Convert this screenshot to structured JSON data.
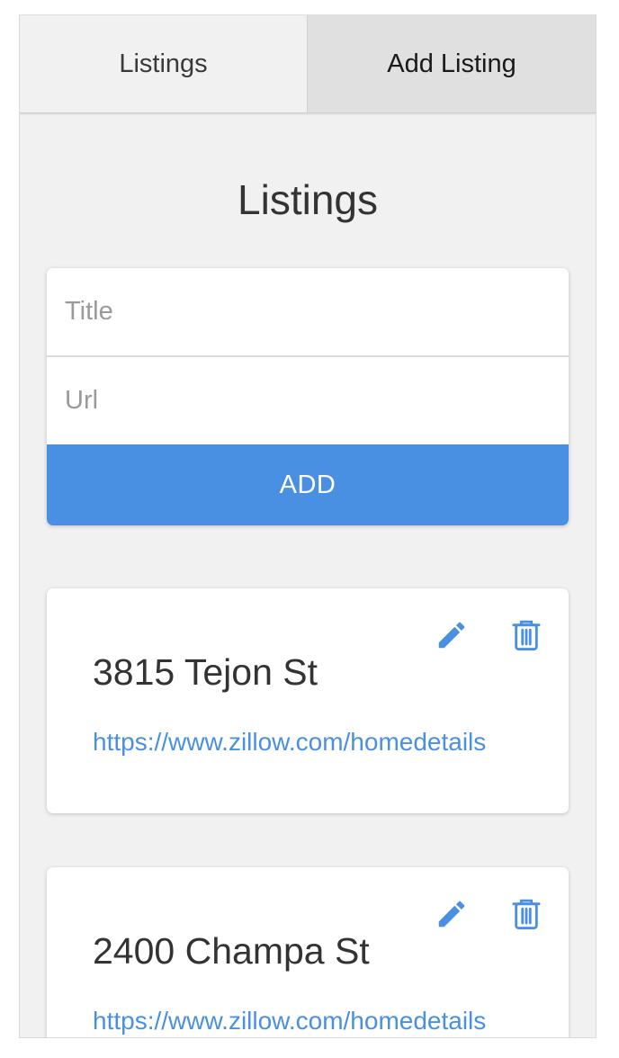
{
  "tabs": [
    {
      "label": "Listings"
    },
    {
      "label": "Add Listing"
    }
  ],
  "page_title": "Listings",
  "form": {
    "title_placeholder": "Title",
    "url_placeholder": "Url",
    "add_label": "ADD"
  },
  "listings": [
    {
      "title": "3815 Tejon St",
      "url": "https://www.zillow.com/homedetails"
    },
    {
      "title": "2400 Champa St",
      "url": "https://www.zillow.com/homedetails"
    }
  ],
  "icons": {
    "edit": "pencil-icon",
    "delete": "trash-icon"
  },
  "colors": {
    "accent": "#4a90e2",
    "background": "#f1f1f1",
    "active_tab": "#e0e0e0",
    "text": "#333333"
  }
}
